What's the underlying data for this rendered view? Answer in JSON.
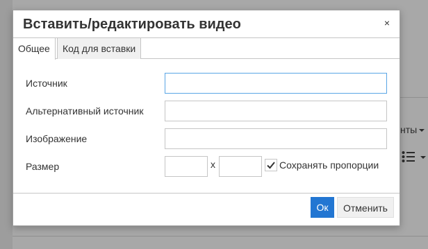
{
  "background": {
    "menu_text": "нты"
  },
  "dialog": {
    "title": "Вставить/редактировать видео",
    "close_label": "×",
    "tabs": [
      {
        "label": "Общее",
        "active": true
      },
      {
        "label": "Код для вставки",
        "active": false
      }
    ],
    "fields": {
      "source_label": "Источник",
      "source_value": "",
      "alt_source_label": "Альтернативный источник",
      "alt_source_value": "",
      "poster_label": "Изображение",
      "poster_value": "",
      "size_label": "Размер",
      "width_value": "",
      "height_value": "",
      "size_separator": "x",
      "constrain_label": "Сохранять пропорции",
      "constrain_checked": true
    },
    "buttons": {
      "ok": "Ок",
      "cancel": "Отменить"
    }
  },
  "colors": {
    "accent": "#2276d2",
    "focus_border": "#59a5e5"
  }
}
